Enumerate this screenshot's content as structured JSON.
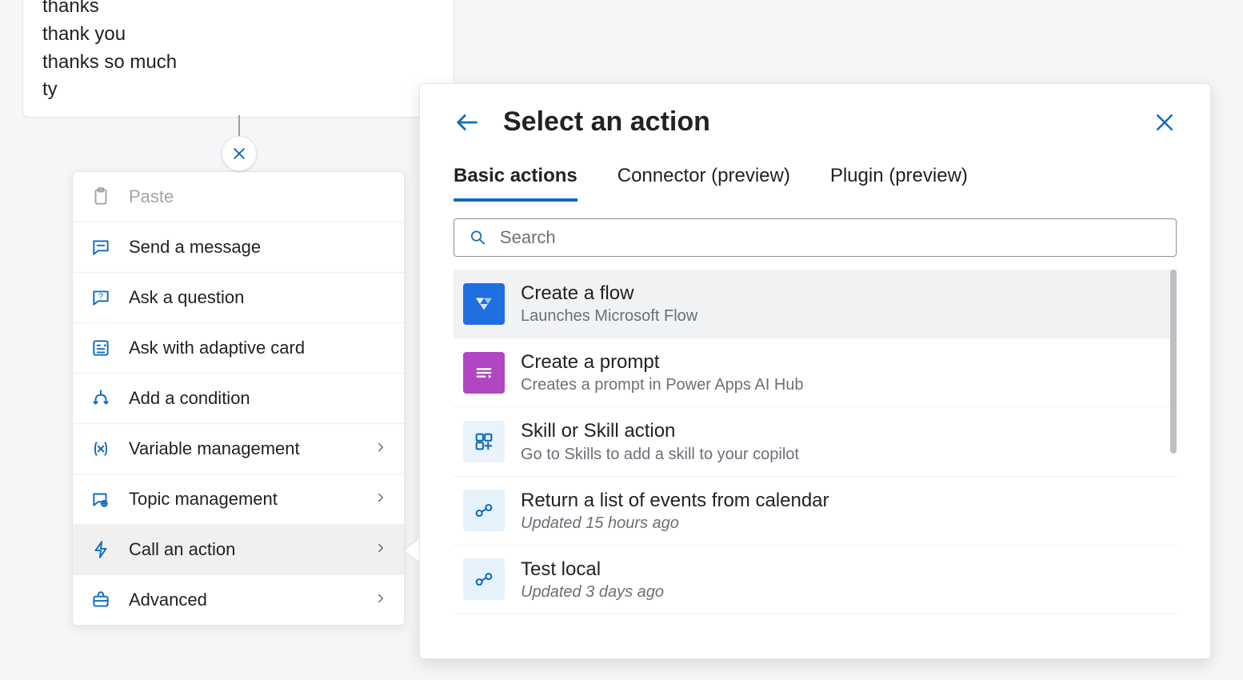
{
  "trigger_phrases": [
    "thanks",
    "thank you",
    "thanks so much",
    "ty"
  ],
  "context_menu": {
    "paste": "Paste",
    "send_message": "Send a message",
    "ask_question": "Ask a question",
    "ask_adaptive": "Ask with adaptive card",
    "add_condition": "Add a condition",
    "variable_mgmt": "Variable management",
    "topic_mgmt": "Topic management",
    "call_action": "Call an action",
    "advanced": "Advanced"
  },
  "panel": {
    "title": "Select an action",
    "tabs": {
      "basic": "Basic actions",
      "connector": "Connector (preview)",
      "plugin": "Plugin (preview)"
    },
    "search_placeholder": "Search",
    "actions": [
      {
        "title": "Create a flow",
        "sub": "Launches Microsoft Flow"
      },
      {
        "title": "Create a prompt",
        "sub": "Creates a prompt in Power Apps AI Hub"
      },
      {
        "title": "Skill or Skill action",
        "sub": "Go to Skills to add a skill to your copilot"
      },
      {
        "title": "Return a list of events from calendar",
        "sub": "Updated 15 hours ago"
      },
      {
        "title": "Test local",
        "sub": "Updated 3 days ago"
      }
    ]
  }
}
